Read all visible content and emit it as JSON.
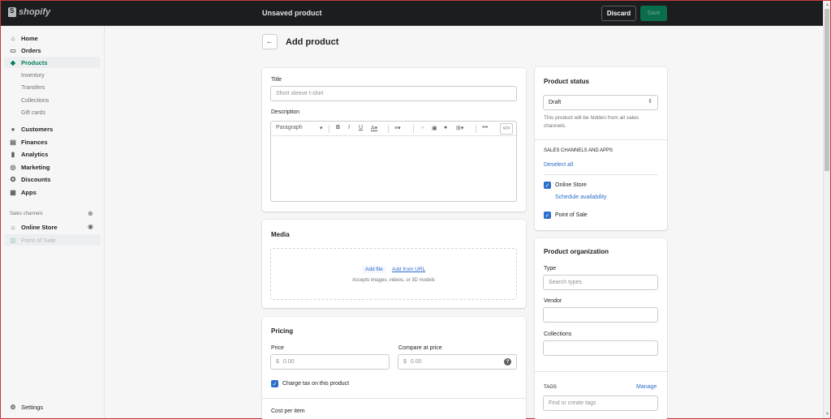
{
  "topbar": {
    "brand": "shopify",
    "title": "Unsaved product",
    "discard_label": "Discard",
    "save_label": "Save"
  },
  "sidebar": {
    "items": [
      {
        "label": "Home",
        "icon": "home-icon"
      },
      {
        "label": "Orders",
        "icon": "orders-icon"
      },
      {
        "label": "Products",
        "icon": "tag-icon",
        "active": true
      },
      {
        "label": "Customers",
        "icon": "person-icon"
      },
      {
        "label": "Finances",
        "icon": "finances-icon"
      },
      {
        "label": "Analytics",
        "icon": "bar-chart-icon"
      },
      {
        "label": "Marketing",
        "icon": "marketing-icon"
      },
      {
        "label": "Discounts",
        "icon": "discount-icon"
      },
      {
        "label": "Apps",
        "icon": "apps-icon"
      }
    ],
    "product_subitems": [
      "Inventory",
      "Transfers",
      "Collections",
      "Gift cards"
    ],
    "sales_channels_label": "Sales channels",
    "channels": [
      {
        "label": "Online Store",
        "icon": "store-icon"
      },
      {
        "label": "Point of Sale",
        "icon": "pos-icon",
        "disabled": true
      }
    ],
    "settings_label": "Settings"
  },
  "page": {
    "title": "Add product"
  },
  "product_card": {
    "title_label": "Title",
    "title_placeholder": "Short sleeve t-shirt",
    "description_label": "Description",
    "paragraph_select": "Paragraph"
  },
  "media": {
    "title": "Media",
    "add_file": "Add file",
    "add_url": "Add from URL",
    "accepts": "Accepts images, videos, or 3D models"
  },
  "pricing": {
    "title": "Pricing",
    "price_label": "Price",
    "price_prefix": "$",
    "price_placeholder": "0.00",
    "compare_label": "Compare at price",
    "compare_prefix": "$",
    "compare_placeholder": "0.00",
    "charge_tax_label": "Charge tax on this product",
    "charge_tax_checked": true,
    "cost_label": "Cost per item"
  },
  "status": {
    "title": "Product status",
    "value": "Draft",
    "help": "This product will be hidden from all sales channels.",
    "channels_heading": "SALES CHANNELS AND APPS",
    "deselect_all": "Deselect all",
    "channels": [
      {
        "label": "Online Store",
        "checked": true
      },
      {
        "label": "Point of Sale",
        "checked": true
      }
    ],
    "schedule_link": "Schedule availability"
  },
  "organization": {
    "title": "Product organization",
    "type_label": "Type",
    "type_placeholder": "Search types",
    "vendor_label": "Vendor",
    "vendor_value": "",
    "collections_label": "Collections",
    "collections_value": "",
    "tags_label": "TAGS",
    "manage_link": "Manage",
    "tags_placeholder": "Find or create tags"
  }
}
